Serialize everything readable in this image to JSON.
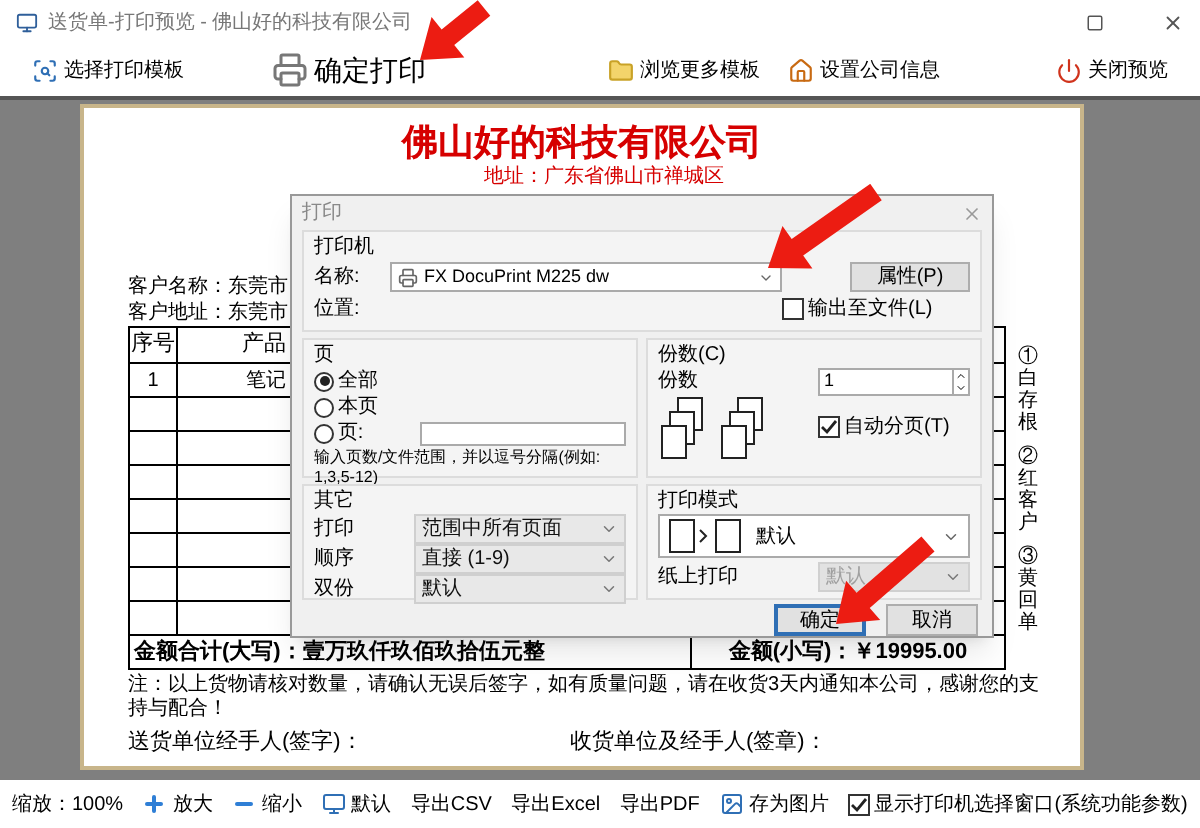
{
  "window": {
    "title": "送货单-打印预览 - 佛山好的科技有限公司"
  },
  "toolbar": [
    {
      "label": "选择打印模板",
      "kind": "template"
    },
    {
      "label": "确定打印",
      "kind": "print"
    },
    {
      "label": "浏览更多模板",
      "kind": "folder"
    },
    {
      "label": "设置公司信息",
      "kind": "home"
    },
    {
      "label": "关闭预览",
      "kind": "close"
    }
  ],
  "document": {
    "company": "佛山好的科技有限公司",
    "address": "地址：广东省佛山市禅城区",
    "customer_name": "客户名称：东莞市",
    "customer_address": "客户地址：东莞市",
    "columns": [
      "序号",
      "产品"
    ],
    "rows": [
      {
        "kind": "item",
        "cells": [
          "1",
          "笔记"
        ]
      },
      {
        "kind": "blank"
      },
      {
        "kind": "blank"
      },
      {
        "kind": "blank"
      },
      {
        "kind": "blank"
      },
      {
        "kind": "blank"
      },
      {
        "kind": "blank"
      },
      {
        "kind": "blank"
      }
    ],
    "total_words": "金额合计(大写)：壹万玖仟玖佰玖拾伍元整",
    "total_amount": "金额(小写)：￥19995.00",
    "note": "注：以上货物请核对数量，请确认无误后签字，如有质量问题，请在收货3天内通知本公司，感谢您的支持与配合！",
    "sign_sender": "送货单位经手人(签字)：",
    "sign_receiver": "收货单位及经手人(签章)：",
    "copies": [
      "①白存根",
      "②红客户",
      "③黄回单"
    ]
  },
  "print_dialog": {
    "title": "打印",
    "printer": {
      "heading": "打印机",
      "name_label": "名称:",
      "name": "FX DocuPrint M225 dw",
      "properties_button": "属性(P)",
      "location_label": "位置:",
      "to_file": {
        "label": "输出至文件(L)",
        "checked": false
      }
    },
    "pages": {
      "heading": "页",
      "options": [
        {
          "label": "全部",
          "selected": true
        },
        {
          "label": "本页",
          "selected": false
        },
        {
          "label": "页:",
          "selected": false
        }
      ],
      "hint": "输入页数/文件范围，并以逗号分隔(例如: 1,3,5-12)"
    },
    "copies": {
      "heading": "份数(C)",
      "label": "份数",
      "value": "1",
      "collate": {
        "label": "自动分页(T)",
        "checked": true
      }
    },
    "other": {
      "heading": "其它",
      "rows": [
        {
          "label": "打印",
          "value": "范围中所有页面"
        },
        {
          "label": "顺序",
          "value": "直接 (1-9)"
        },
        {
          "label": "双份",
          "value": "默认"
        }
      ]
    },
    "mode": {
      "heading": "打印模式",
      "value": "默认",
      "paper": {
        "label": "纸上打印",
        "value": "默认",
        "disabled": true
      }
    },
    "buttons": [
      {
        "label": "确定",
        "kind": "default"
      },
      {
        "label": "取消",
        "kind": "normal"
      }
    ]
  },
  "status_bar": {
    "zoom": "缩放：100%",
    "actions": [
      {
        "label": "放大",
        "kind": "zoom_in"
      },
      {
        "label": "缩小",
        "kind": "zoom_out"
      },
      {
        "label": "默认",
        "kind": "reset"
      },
      {
        "label": "导出CSV",
        "kind": "text"
      },
      {
        "label": "导出Excel",
        "kind": "text"
      },
      {
        "label": "导出PDF",
        "kind": "text"
      },
      {
        "label": "存为图片",
        "kind": "image"
      }
    ],
    "show_printer": {
      "label": "显示打印机选择窗口(系统功能参数)",
      "checked": true
    }
  }
}
